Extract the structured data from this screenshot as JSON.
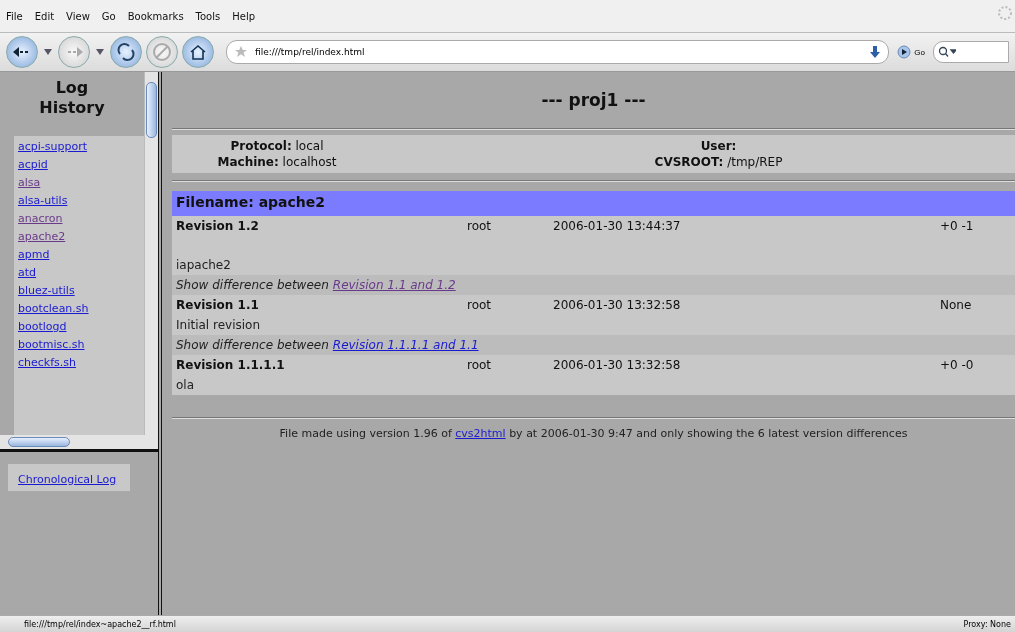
{
  "menu": [
    "File",
    "Edit",
    "View",
    "Go",
    "Bookmarks",
    "Tools",
    "Help"
  ],
  "toolbar": {
    "url": "file:///tmp/rel/index.html",
    "go_label": "Go"
  },
  "sidebar": {
    "title": "Log History",
    "items": [
      {
        "label": "acpi-support",
        "visited": false
      },
      {
        "label": "acpid",
        "visited": false
      },
      {
        "label": "alsa",
        "visited": true
      },
      {
        "label": "alsa-utils",
        "visited": false
      },
      {
        "label": "anacron",
        "visited": true
      },
      {
        "label": "apache2",
        "visited": true
      },
      {
        "label": "apmd",
        "visited": false
      },
      {
        "label": "atd",
        "visited": false
      },
      {
        "label": "bluez-utils",
        "visited": false
      },
      {
        "label": "bootclean.sh",
        "visited": false
      },
      {
        "label": "bootlogd",
        "visited": false
      },
      {
        "label": "bootmisc.sh",
        "visited": false
      },
      {
        "label": "checkfs.sh",
        "visited": false
      }
    ],
    "bottom_link": {
      "label": "Chronological Log",
      "visited": false
    }
  },
  "page": {
    "title": "--- proj1 ---",
    "info": [
      {
        "label": "Protocol:",
        "value": "local"
      },
      {
        "label": "User:"
      },
      {
        "label": "Machine:",
        "value": "localhost"
      },
      {
        "label": "CVSROOT:",
        "value": "/tmp/REP"
      }
    ],
    "filename": "Filename: apache2",
    "entries": [
      {
        "kind": "revision",
        "revision": "Revision 1.2",
        "author": "root",
        "date": "2006-01-30 13:44:37",
        "changes": "+0 -1",
        "message": "iapache2",
        "gap": true
      },
      {
        "kind": "diff",
        "prefix": "Show difference between",
        "link": "Revision 1.1 and 1.2",
        "visited": true
      },
      {
        "kind": "revision",
        "revision": "Revision 1.1",
        "author": "root",
        "date": "2006-01-30 13:32:58",
        "changes": "None",
        "message": "Initial revision",
        "gap": false
      },
      {
        "kind": "diff",
        "prefix": "Show difference between",
        "link": "Revision 1.1.1.1 and 1.1",
        "visited": false
      },
      {
        "kind": "revision",
        "revision": "Revision 1.1.1.1",
        "author": "root",
        "date": "2006-01-30 13:32:58",
        "changes": "+0 -0",
        "message": "ola",
        "gap": false
      }
    ],
    "footer": {
      "before": "File made using version 1.96 of",
      "link": "cvs2html",
      "after": "by at 2006-01-30 9:47 and only showing the 6 latest version differences"
    }
  },
  "status": {
    "url": "file:///tmp/rel/index~apache2__rf.html",
    "proxy": "Proxy: None"
  }
}
